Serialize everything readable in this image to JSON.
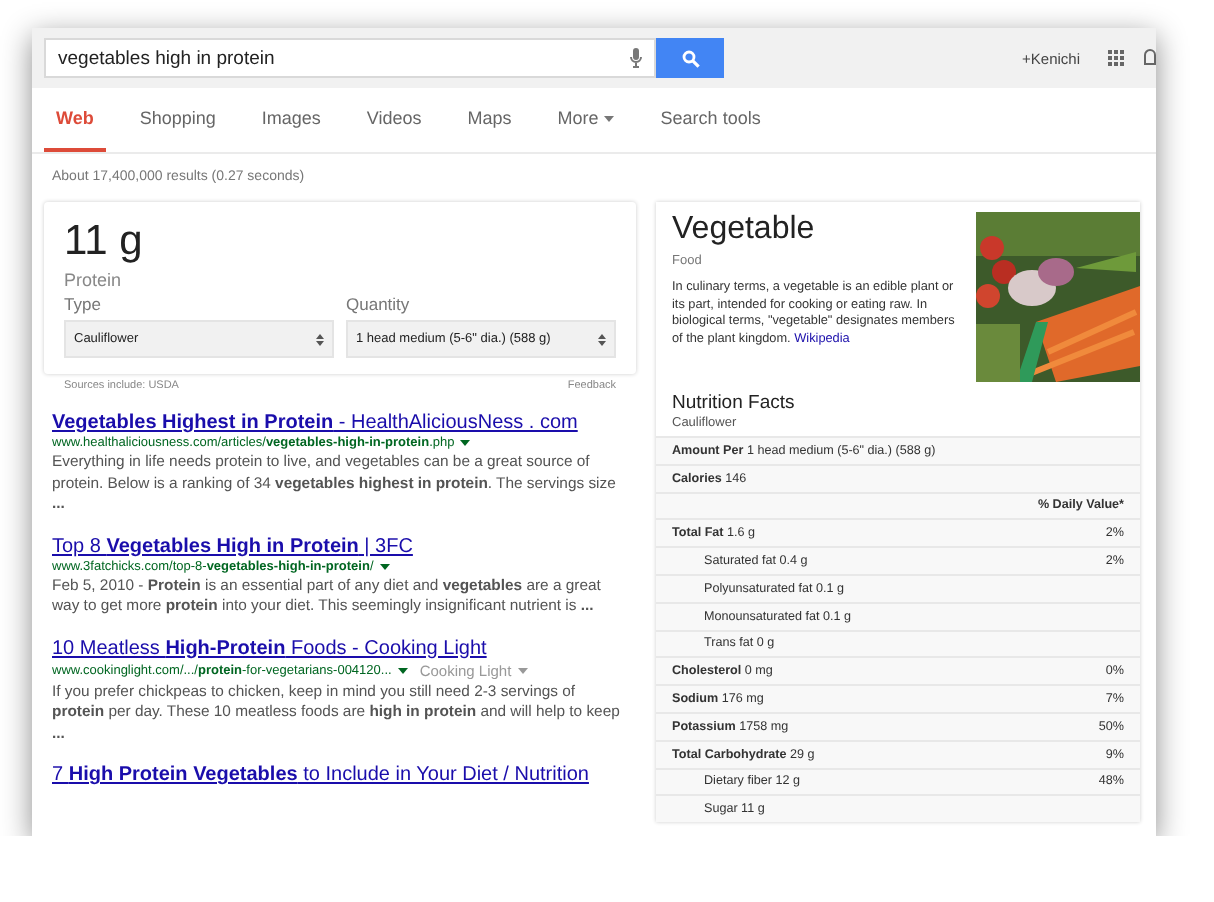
{
  "search": {
    "query": "vegetables high in protein"
  },
  "account": {
    "name": "+Kenichi"
  },
  "tabs": [
    {
      "label": "Web",
      "selected": true,
      "kind": "tab"
    },
    {
      "label": "Shopping",
      "selected": false,
      "kind": "tab"
    },
    {
      "label": "Images",
      "selected": false,
      "kind": "tab"
    },
    {
      "label": "Videos",
      "selected": false,
      "kind": "tab"
    },
    {
      "label": "Maps",
      "selected": false,
      "kind": "tab"
    },
    {
      "label": "More",
      "selected": false,
      "kind": "menu"
    },
    {
      "label": "Search tools",
      "selected": false,
      "kind": "tab"
    }
  ],
  "result_stats": "About 17,400,000 results (0.27 seconds)",
  "nutrition_card": {
    "value": "11 g",
    "nutrient": "Protein",
    "type_label": "Type",
    "type_value": "Cauliflower",
    "quantity_label": "Quantity",
    "quantity_value": "1 head medium (5-6\" dia.) (588 g)",
    "sources": "Sources include: USDA",
    "feedback": "Feedback"
  },
  "results": [
    {
      "title": "**Vegetables Highest in Protein** - HealthAliciousNess . com",
      "url": "www.healthaliciousness.com/articles/**vegetables-high-in-protein**.php",
      "snippet": "Everything in life needs protein to live, and vegetables can be a great source of protein. Below is a ranking of 34 **vegetables highest in protein**. The servings size **...**"
    },
    {
      "title": "Top 8 **Vegetables High in Protein** | 3FC",
      "url": "www.3fatchicks.com/top-8-**vegetables-high-in-protein**/",
      "snippet": "Feb 5, 2010 - **Protein** is an essential part of any diet and **vegetables** are a great way to get more **protein** into your diet. This seemingly insignificant nutrient is **...**"
    },
    {
      "title": "10 Meatless **High-Protein** Foods - Cooking Light",
      "url": "www.cookinglight.com/.../**protein**-for-vegetarians-004120...",
      "source": "Cooking Light",
      "snippet": "If you prefer chickpeas to chicken, keep in mind you still need 2-3 servings of **protein** per day. These 10 meatless foods are **high in protein** and will help to keep **...**"
    },
    {
      "title": "7 **High Protein Vegetables** to Include in Your Diet / Nutrition"
    }
  ],
  "knowledge_panel": {
    "title": "Vegetable",
    "subtitle": "Food",
    "description": "In culinary terms, a vegetable is an edible plant or its part, intended for cooking or eating raw. In biological terms, \"vegetable\" designates members of the plant kingdom.",
    "link": "Wikipedia",
    "nutrition_title": "Nutrition Facts",
    "nutrition_subtitle": "Cauliflower",
    "amount_label": "Amount Per",
    "amount_value": "1 head medium (5-6\" dia.) (588 g)",
    "calories_label": "Calories",
    "calories_value": "146",
    "daily_value_header": "% Daily Value*",
    "rows": [
      {
        "kind": "main",
        "label": "Total Fat",
        "value": "1.6 g",
        "percent": "2%"
      },
      {
        "kind": "sub",
        "label": "Saturated fat 0.4 g",
        "percent": "2%"
      },
      {
        "kind": "sub",
        "label": "Polyunsaturated fat 0.1 g"
      },
      {
        "kind": "sub",
        "label": "Monounsaturated fat 0.1 g"
      },
      {
        "kind": "sub",
        "label": "Trans fat 0 g"
      },
      {
        "kind": "main",
        "label": "Cholesterol",
        "value": "0 mg",
        "percent": "0%"
      },
      {
        "kind": "main",
        "label": "Sodium",
        "value": "176 mg",
        "percent": "7%"
      },
      {
        "kind": "main",
        "label": "Potassium",
        "value": "1758 mg",
        "percent": "50%"
      },
      {
        "kind": "main",
        "label": "Total Carbohydrate",
        "value": "29 g",
        "percent": "9%"
      },
      {
        "kind": "sub",
        "label": "Dietary fiber 12 g",
        "percent": "48%"
      },
      {
        "kind": "sub",
        "label": "Sugar 11 g"
      }
    ]
  }
}
